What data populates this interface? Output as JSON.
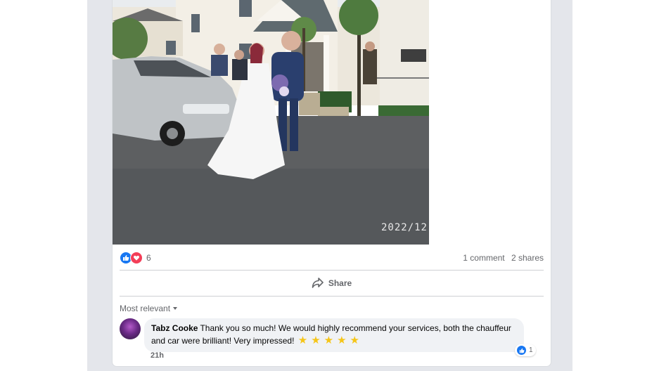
{
  "photo": {
    "timestamp": "2022/12"
  },
  "stats": {
    "reaction_count": "6",
    "comments": "1 comment",
    "shares": "2 shares",
    "reaction_icons": [
      "like-icon",
      "love-icon"
    ]
  },
  "actions": {
    "share_label": "Share",
    "share_icon": "share-arrow-icon"
  },
  "comments": {
    "sort_label": "Most relevant",
    "items": [
      {
        "author": "Tabz Cooke",
        "text": "Thank you so much! We would highly recommend your services, both the chauffeur and car were brilliant! Very impressed!",
        "stars": "★★★★★",
        "like_count": "1",
        "time": "21h"
      }
    ]
  },
  "colors": {
    "accent": "#1877f2",
    "love": "#f33e58",
    "muted_text": "#65676b",
    "bubble": "#f0f2f5"
  }
}
